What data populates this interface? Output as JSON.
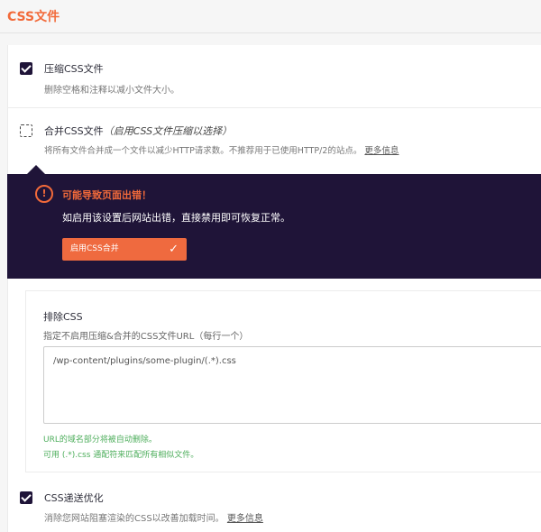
{
  "section_title": "CSS文件",
  "minify_css": {
    "checked": true,
    "label": "压缩CSS文件",
    "description": "删除空格和注释以减小文件大小。"
  },
  "combine_css": {
    "checked": false,
    "label": "合并CSS文件",
    "label_note": "（启用CSS文件压缩以选择）",
    "description": "将所有文件合并成一个文件以减少HTTP请求数。不推荐用于已使用HTTP/2的站点。",
    "more_info": "更多信息"
  },
  "notice": {
    "title": "可能导致页面出错！",
    "text": "如启用该设置后网站出错，直接禁用即可恢复正常。",
    "button_label": "启用CSS合并"
  },
  "exclude_css": {
    "label": "排除CSS",
    "description": "指定不启用压缩&合并的CSS文件URL（每行一个）",
    "value": "/wp-content/plugins/some-plugin/(.*).css",
    "hint_1": "URL的域名部分将被自动删除。",
    "hint_2": "可用 (.*).css 通配符来匹配所有相似文件。"
  },
  "optimize_delivery": {
    "checked": true,
    "label": "CSS递送优化",
    "description": "消除您网站阻塞渲染的CSS以改善加载时间。",
    "more_info": "更多信息"
  },
  "colors": {
    "accent": "#f26a3a",
    "notice_bg": "#1f1438",
    "hint_green": "#4eae5c"
  }
}
